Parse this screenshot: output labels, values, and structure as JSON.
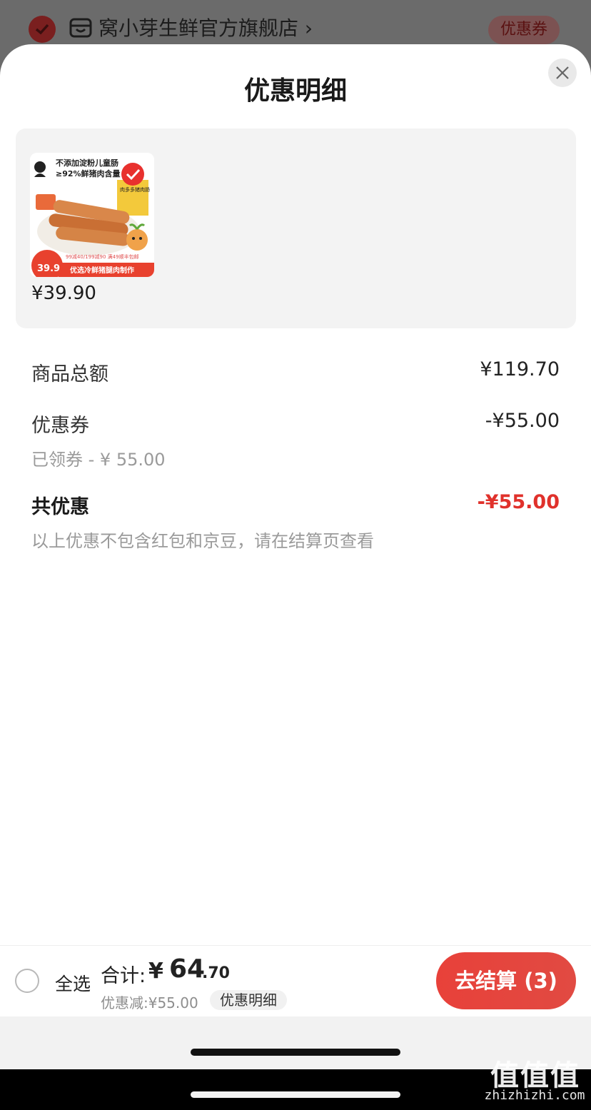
{
  "store": {
    "name": "窝小芽生鲜官方旗舰店",
    "chevron": "›",
    "coupon_label": "优惠券"
  },
  "sheet": {
    "title": "优惠明细",
    "close_icon": "close-icon"
  },
  "product": {
    "price": "¥39.90",
    "image_text": {
      "line1": "不添加淀粉儿童肠",
      "line2": "≥92%鲜猪肉含量",
      "badge": "肉多多猪肉肠",
      "promo": "99减40/199减90 满49顺丰包邮",
      "banner": "优选冷鲜猪腿肉制作",
      "price_tag": "39.9"
    }
  },
  "summary": {
    "goods_total_label": "商品总额",
    "goods_total_value": "¥119.70",
    "coupon_label": "优惠券",
    "coupon_value": "-¥55.00",
    "coupon_sub": "已领券 - ¥ 55.00",
    "total_discount_label": "共优惠",
    "total_discount_value": "-¥55.00",
    "note": "以上优惠不包含红包和京豆，请在结算页查看"
  },
  "footer": {
    "select_all_label": "全选",
    "total_label": "合计:",
    "total_yen": "¥",
    "total_int": "64",
    "total_dec": ".70",
    "discount_label": "优惠减:¥55.00",
    "detail_chip": "优惠明细",
    "checkout_label": "去结算 (3)"
  },
  "watermark": {
    "logo": "值值值",
    "site": "zhizhizhi.com"
  },
  "colors": {
    "accent_red": "#e0312b",
    "checkout_red": "#e8413a",
    "card_bg": "#f3f3f3"
  }
}
